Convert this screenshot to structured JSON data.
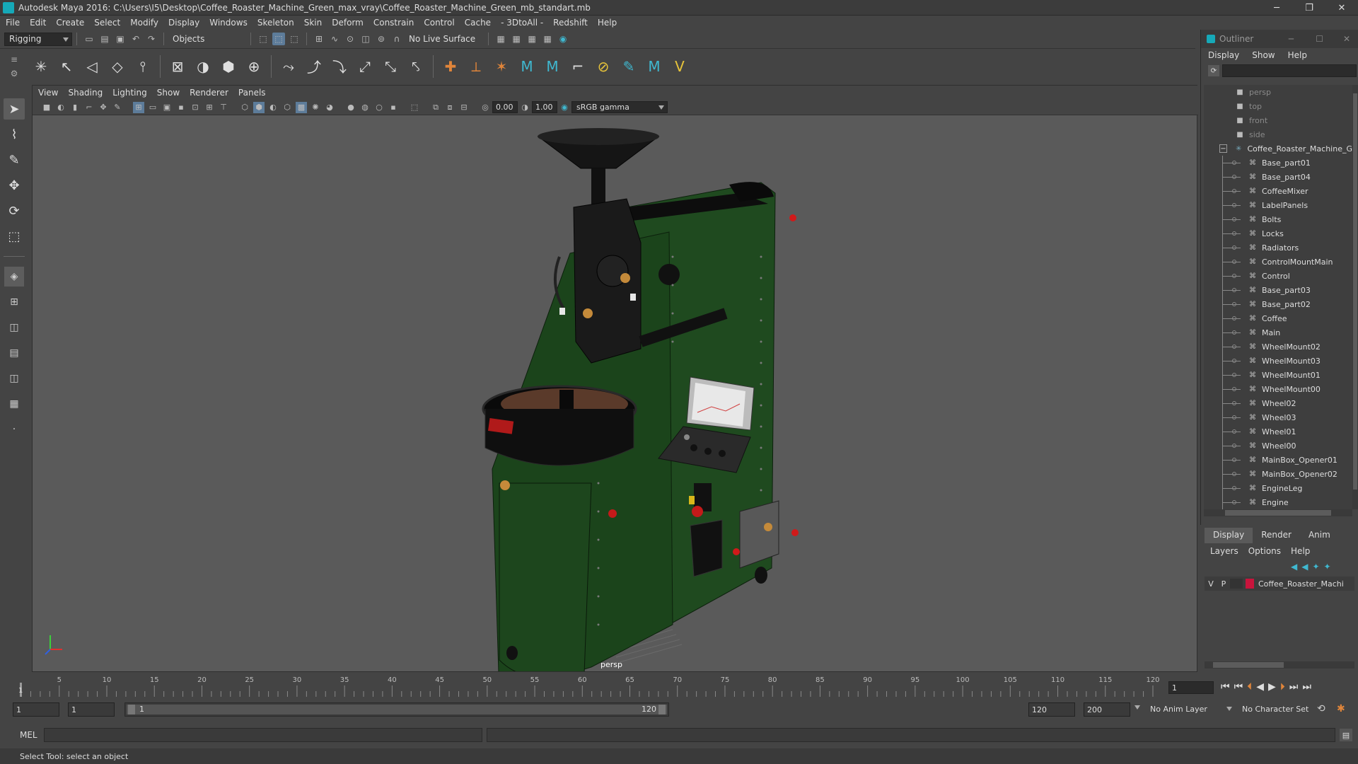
{
  "window": {
    "title": "Autodesk Maya 2016: C:\\Users\\I5\\Desktop\\Coffee_Roaster_Machine_Green_max_vray\\Coffee_Roaster_Machine_Green_mb_standart.mb",
    "controls": [
      "─",
      "❐",
      "✕"
    ]
  },
  "menubar": [
    "File",
    "Edit",
    "Create",
    "Select",
    "Modify",
    "Display",
    "Windows",
    "Skeleton",
    "Skin",
    "Deform",
    "Constrain",
    "Control",
    "Cache",
    "- 3DtoAll -",
    "Redshift",
    "Help"
  ],
  "statusline": {
    "mode": "Rigging",
    "selection_mask": "Objects",
    "live_surface": "No Live Surface"
  },
  "viewport": {
    "menu": [
      "View",
      "Shading",
      "Lighting",
      "Show",
      "Renderer",
      "Panels"
    ],
    "exposure": "0.00",
    "gamma": "1.00",
    "color_space": "sRGB gamma",
    "camera_label": "persp"
  },
  "outliner": {
    "title": "Outliner",
    "menu": [
      "Display",
      "Show",
      "Help"
    ],
    "cameras": [
      "persp",
      "top",
      "front",
      "side"
    ],
    "root": "Coffee_Roaster_Machine_G",
    "children": [
      "Base_part01",
      "Base_part04",
      "CoffeeMixer",
      "LabelPanels",
      "Bolts",
      "Locks",
      "Radiators",
      "ControlMountMain",
      "Control",
      "Base_part03",
      "Base_part02",
      "Coffee",
      "Main",
      "WheelMount02",
      "WheelMount03",
      "WheelMount01",
      "WheelMount00",
      "Wheel02",
      "Wheel03",
      "Wheel01",
      "Wheel00",
      "MainBox_Opener01",
      "MainBox_Opener02",
      "EngineLeg",
      "Engine"
    ]
  },
  "layers": {
    "tabs": [
      "Display",
      "Render",
      "Anim"
    ],
    "active_tab": "Display",
    "menu": [
      "Layers",
      "Options",
      "Help"
    ],
    "row": {
      "v": "V",
      "p": "P",
      "name": "Coffee_Roaster_Machi",
      "color": "#c8143c"
    }
  },
  "timeline": {
    "ticks": [
      "5",
      "10",
      "15",
      "20",
      "25",
      "30",
      "35",
      "40",
      "45",
      "50",
      "55",
      "60",
      "65",
      "70",
      "75",
      "80",
      "85",
      "90",
      "95",
      "100",
      "105",
      "110",
      "115",
      "120"
    ],
    "current_frame": "1",
    "first_tick": "1"
  },
  "range": {
    "start": "1",
    "start_inner": "1",
    "slider_start": "1",
    "slider_end": "120",
    "end_inner": "120",
    "end": "200",
    "anim_layer": "No Anim Layer",
    "character_set": "No Character Set"
  },
  "cmdline": {
    "label": "MEL"
  },
  "helpline": {
    "text": "Select Tool: select an object"
  },
  "colors": {
    "accent": "#16a9b8",
    "machine_green": "#1e4a1e",
    "layer_color": "#c8143c"
  }
}
